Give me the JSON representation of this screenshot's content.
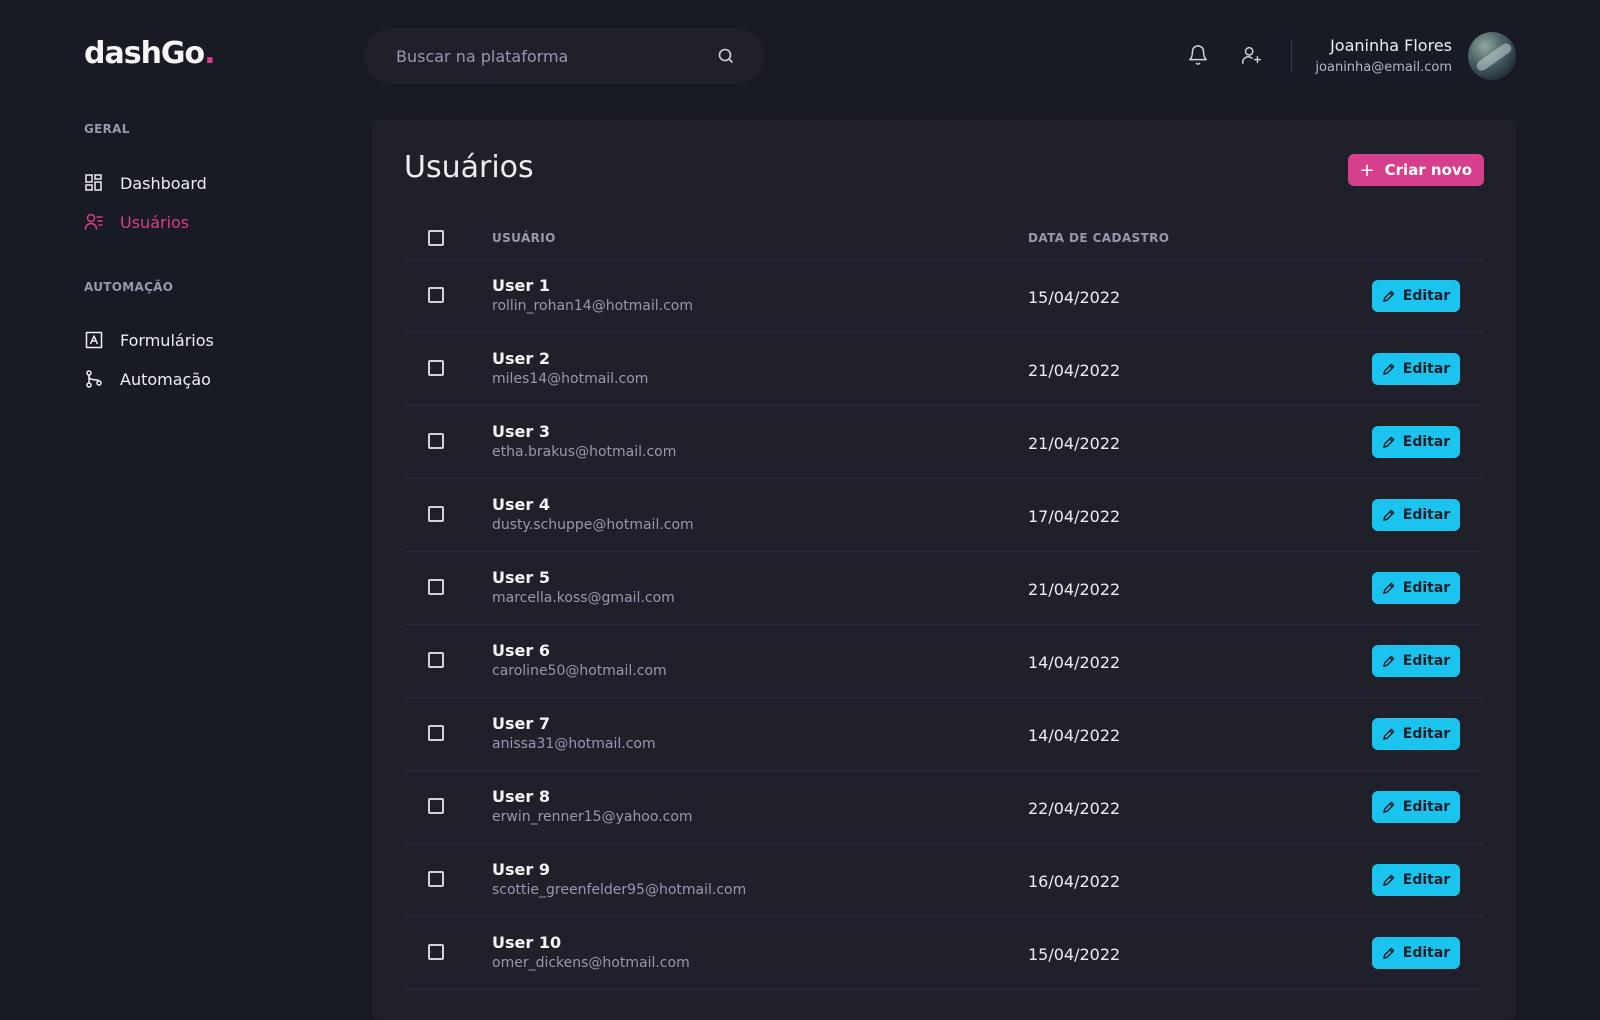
{
  "app": {
    "logo_text": "dashGo",
    "logo_dot": "."
  },
  "search": {
    "placeholder": "Buscar na plataforma"
  },
  "profile": {
    "name": "Joaninha Flores",
    "email": "joaninha@email.com"
  },
  "sidebar": {
    "sections": [
      {
        "title": "GERAL",
        "items": [
          {
            "label": "Dashboard",
            "icon": "dashboard-grid-icon",
            "active": false
          },
          {
            "label": "Usuários",
            "icon": "users-icon",
            "active": true
          }
        ]
      },
      {
        "title": "AUTOMAÇÃO",
        "items": [
          {
            "label": "Formulários",
            "icon": "form-icon",
            "active": false
          },
          {
            "label": "Automação",
            "icon": "git-branch-icon",
            "active": false
          }
        ]
      }
    ]
  },
  "main": {
    "title": "Usuários",
    "create_label": "Criar novo",
    "edit_label": "Editar",
    "columns": [
      "USUÁRIO",
      "DATA DE CADASTRO"
    ],
    "users": [
      {
        "name": "User 1",
        "email": "rollin_rohan14@hotmail.com",
        "date": "15/04/2022"
      },
      {
        "name": "User 2",
        "email": "miles14@hotmail.com",
        "date": "21/04/2022"
      },
      {
        "name": "User 3",
        "email": "etha.brakus@hotmail.com",
        "date": "21/04/2022"
      },
      {
        "name": "User 4",
        "email": "dusty.schuppe@hotmail.com",
        "date": "17/04/2022"
      },
      {
        "name": "User 5",
        "email": "marcella.koss@gmail.com",
        "date": "21/04/2022"
      },
      {
        "name": "User 6",
        "email": "caroline50@hotmail.com",
        "date": "14/04/2022"
      },
      {
        "name": "User 7",
        "email": "anissa31@hotmail.com",
        "date": "14/04/2022"
      },
      {
        "name": "User 8",
        "email": "erwin_renner15@yahoo.com",
        "date": "22/04/2022"
      },
      {
        "name": "User 9",
        "email": "scottie_greenfelder95@hotmail.com",
        "date": "16/04/2022"
      },
      {
        "name": "User 10",
        "email": "omer_dickens@hotmail.com",
        "date": "15/04/2022"
      }
    ]
  },
  "colors": {
    "background": "#181b23",
    "panel": "#1f2029",
    "accent_pink": "#d53f8c",
    "accent_cyan": "#1bc4ef",
    "muted_text": "#9699b0"
  }
}
